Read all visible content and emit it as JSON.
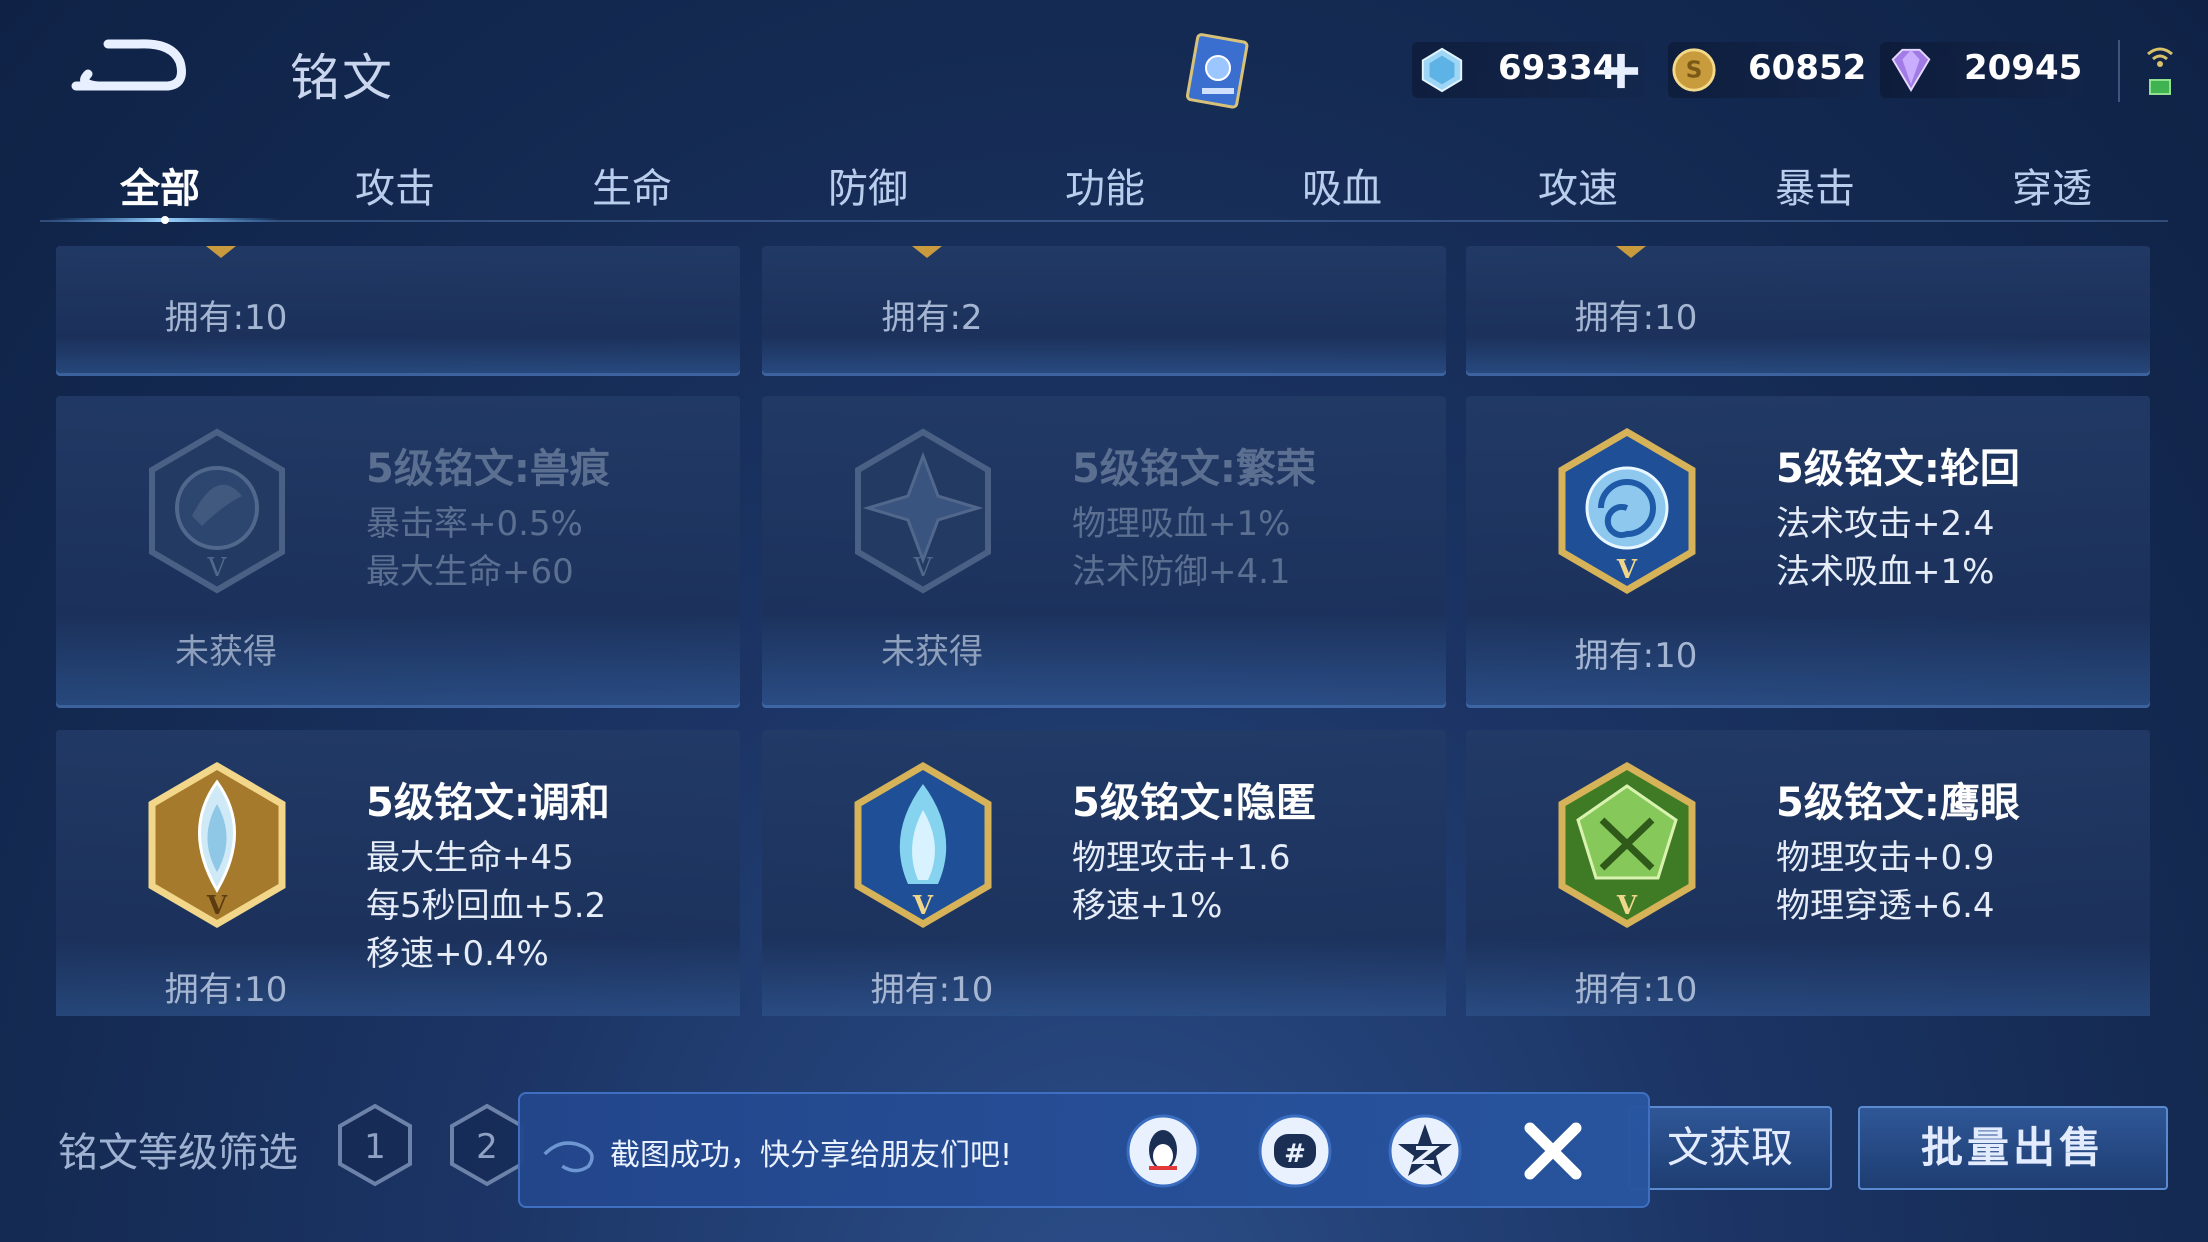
{
  "header": {
    "title": "铭文",
    "back_icon": "back-arrow-icon",
    "currencies": [
      {
        "name": "diamond",
        "icon": "crystal-icon",
        "value": "69334",
        "has_add": true
      },
      {
        "name": "gold",
        "icon": "gold-coin-icon",
        "value": "60852"
      },
      {
        "name": "gem",
        "icon": "purple-gem-icon",
        "value": "20945"
      }
    ]
  },
  "tabs": [
    "全部",
    "攻击",
    "生命",
    "防御",
    "功能",
    "吸血",
    "攻速",
    "暴击",
    "穿透"
  ],
  "active_tab": "全部",
  "top_row": [
    {
      "own": "拥有:10"
    },
    {
      "own": "拥有:2"
    },
    {
      "own": "拥有:10"
    }
  ],
  "cards": [
    {
      "name": "5级铭文:兽痕",
      "attrs": [
        "暴击率+0.5%",
        "最大生命+60"
      ],
      "own": "未获得",
      "obtained": false,
      "color": "#3e5a86"
    },
    {
      "name": "5级铭文:繁荣",
      "attrs": [
        "物理吸血+1%",
        "法术防御+4.1"
      ],
      "own": "未获得",
      "obtained": false,
      "color": "#3e5a86"
    },
    {
      "name": "5级铭文:轮回",
      "attrs": [
        "法术攻击+2.4",
        "法术吸血+1%"
      ],
      "own": "拥有:10",
      "obtained": true,
      "color": "#2f6fb8"
    },
    {
      "name": "5级铭文:调和",
      "attrs": [
        "最大生命+45",
        "每5秒回血+5.2",
        "移速+0.4%"
      ],
      "own": "拥有:10",
      "obtained": true,
      "color": "#8a6a2e"
    },
    {
      "name": "5级铭文:隐匿",
      "attrs": [
        "物理攻击+1.6",
        "移速+1%"
      ],
      "own": "拥有:10",
      "obtained": true,
      "color": "#2f6fb8"
    },
    {
      "name": "5级铭文:鹰眼",
      "attrs": [
        "物理攻击+0.9",
        "物理穿透+6.4"
      ],
      "own": "拥有:10",
      "obtained": true,
      "color": "#4f8a2e"
    }
  ],
  "footer": {
    "filter_label": "铭文等级筛选",
    "levels": [
      "1",
      "2"
    ],
    "get_button": "文获取",
    "sell_button": "批量出售"
  },
  "toast": {
    "message": "截图成功，快分享给朋友们吧!",
    "share_icons": [
      "qq-icon",
      "wechat-moments-icon",
      "qzone-icon"
    ],
    "close_icon": "close-icon"
  }
}
